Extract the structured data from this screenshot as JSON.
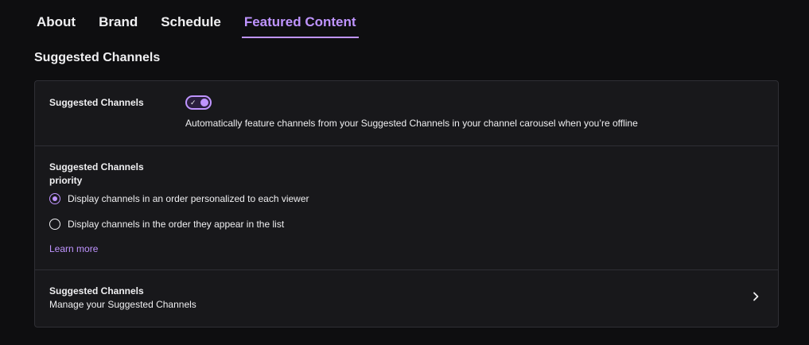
{
  "tabs": [
    {
      "label": "About"
    },
    {
      "label": "Brand"
    },
    {
      "label": "Schedule"
    },
    {
      "label": "Featured Content",
      "active": true
    }
  ],
  "section_title": "Suggested Channels",
  "toggle_row": {
    "label": "Suggested Channels",
    "enabled": true,
    "description": "Automatically feature channels from your Suggested Channels in your channel carousel when you’re offline"
  },
  "priority_row": {
    "label": "Suggested Channels priority",
    "options": [
      {
        "label": "Display channels in an order personalized to each viewer",
        "selected": true
      },
      {
        "label": "Display channels in the order they appear in the list",
        "selected": false
      }
    ],
    "learn_more": "Learn more"
  },
  "manage_row": {
    "title": "Suggested Channels",
    "subtitle": "Manage your Suggested Channels"
  },
  "colors": {
    "accent": "#bf94ff",
    "background": "#0e0e10",
    "card": "#18181b",
    "border": "#2f2f35"
  }
}
